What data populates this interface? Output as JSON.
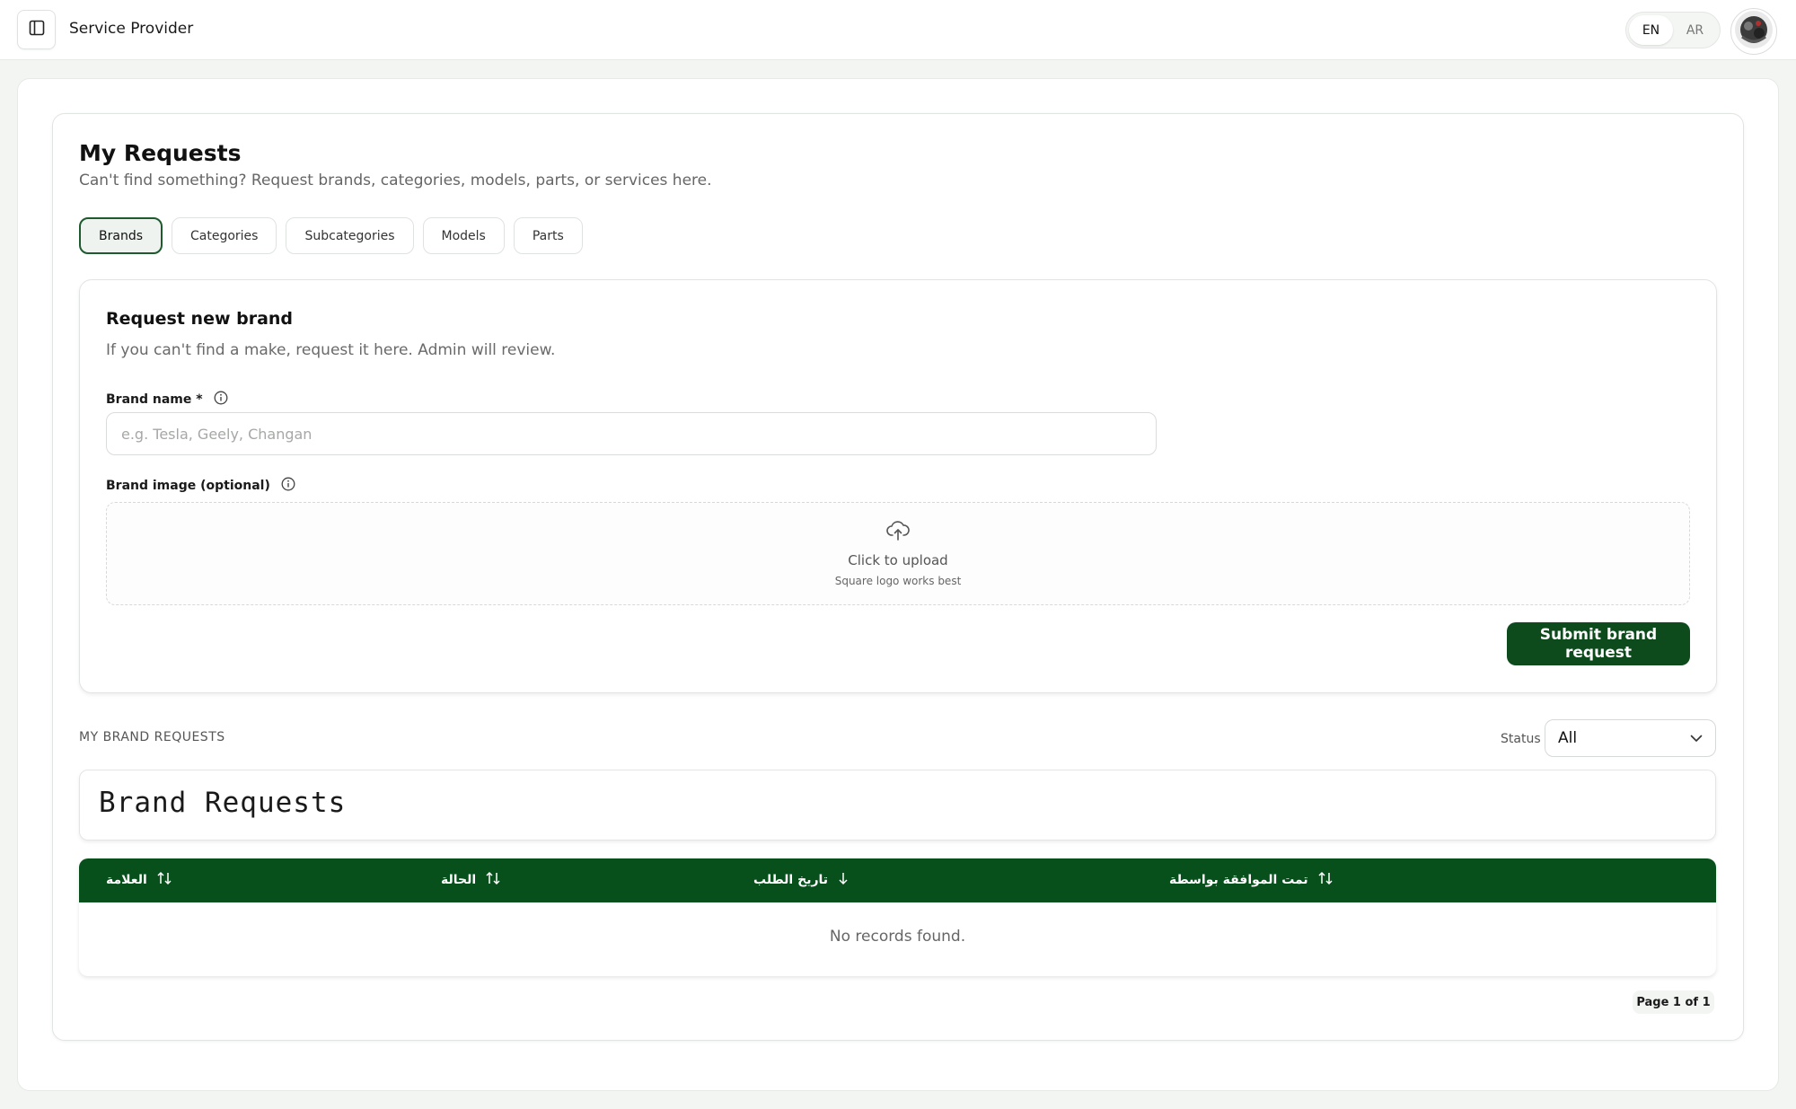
{
  "app": {
    "title": "Service Provider"
  },
  "language": {
    "options": [
      "EN",
      "AR"
    ],
    "active": "EN"
  },
  "page": {
    "title": "My Requests",
    "subtitle": "Can't find something? Request brands, categories, models, parts, or services here."
  },
  "tabs": [
    {
      "label": "Brands",
      "active": true
    },
    {
      "label": "Categories",
      "active": false
    },
    {
      "label": "Subcategories",
      "active": false
    },
    {
      "label": "Models",
      "active": false
    },
    {
      "label": "Parts",
      "active": false
    }
  ],
  "form": {
    "title": "Request new brand",
    "subtitle": "If you can't find a make, request it here. Admin will review.",
    "brand_name_label": "Brand name *",
    "brand_name_placeholder": "e.g. Tesla, Geely, Changan",
    "brand_image_label": "Brand image (optional)",
    "upload_main": "Click to upload",
    "upload_hint": "Square logo works best",
    "submit_label": "Submit brand request"
  },
  "list": {
    "heading": "MY BRAND REQUESTS",
    "status_label": "Status",
    "status_value": "All",
    "table_title": "Brand Requests",
    "columns": [
      "العلامة",
      "الحالة",
      "تاريخ الطلب",
      "تمت الموافقة بواسطة"
    ],
    "empty_message": "No records found.",
    "pagination": "Page 1 of 1"
  },
  "colors": {
    "primary": "#0d4a1c",
    "table_header": "#07501c",
    "background": "#f3f5f3"
  }
}
